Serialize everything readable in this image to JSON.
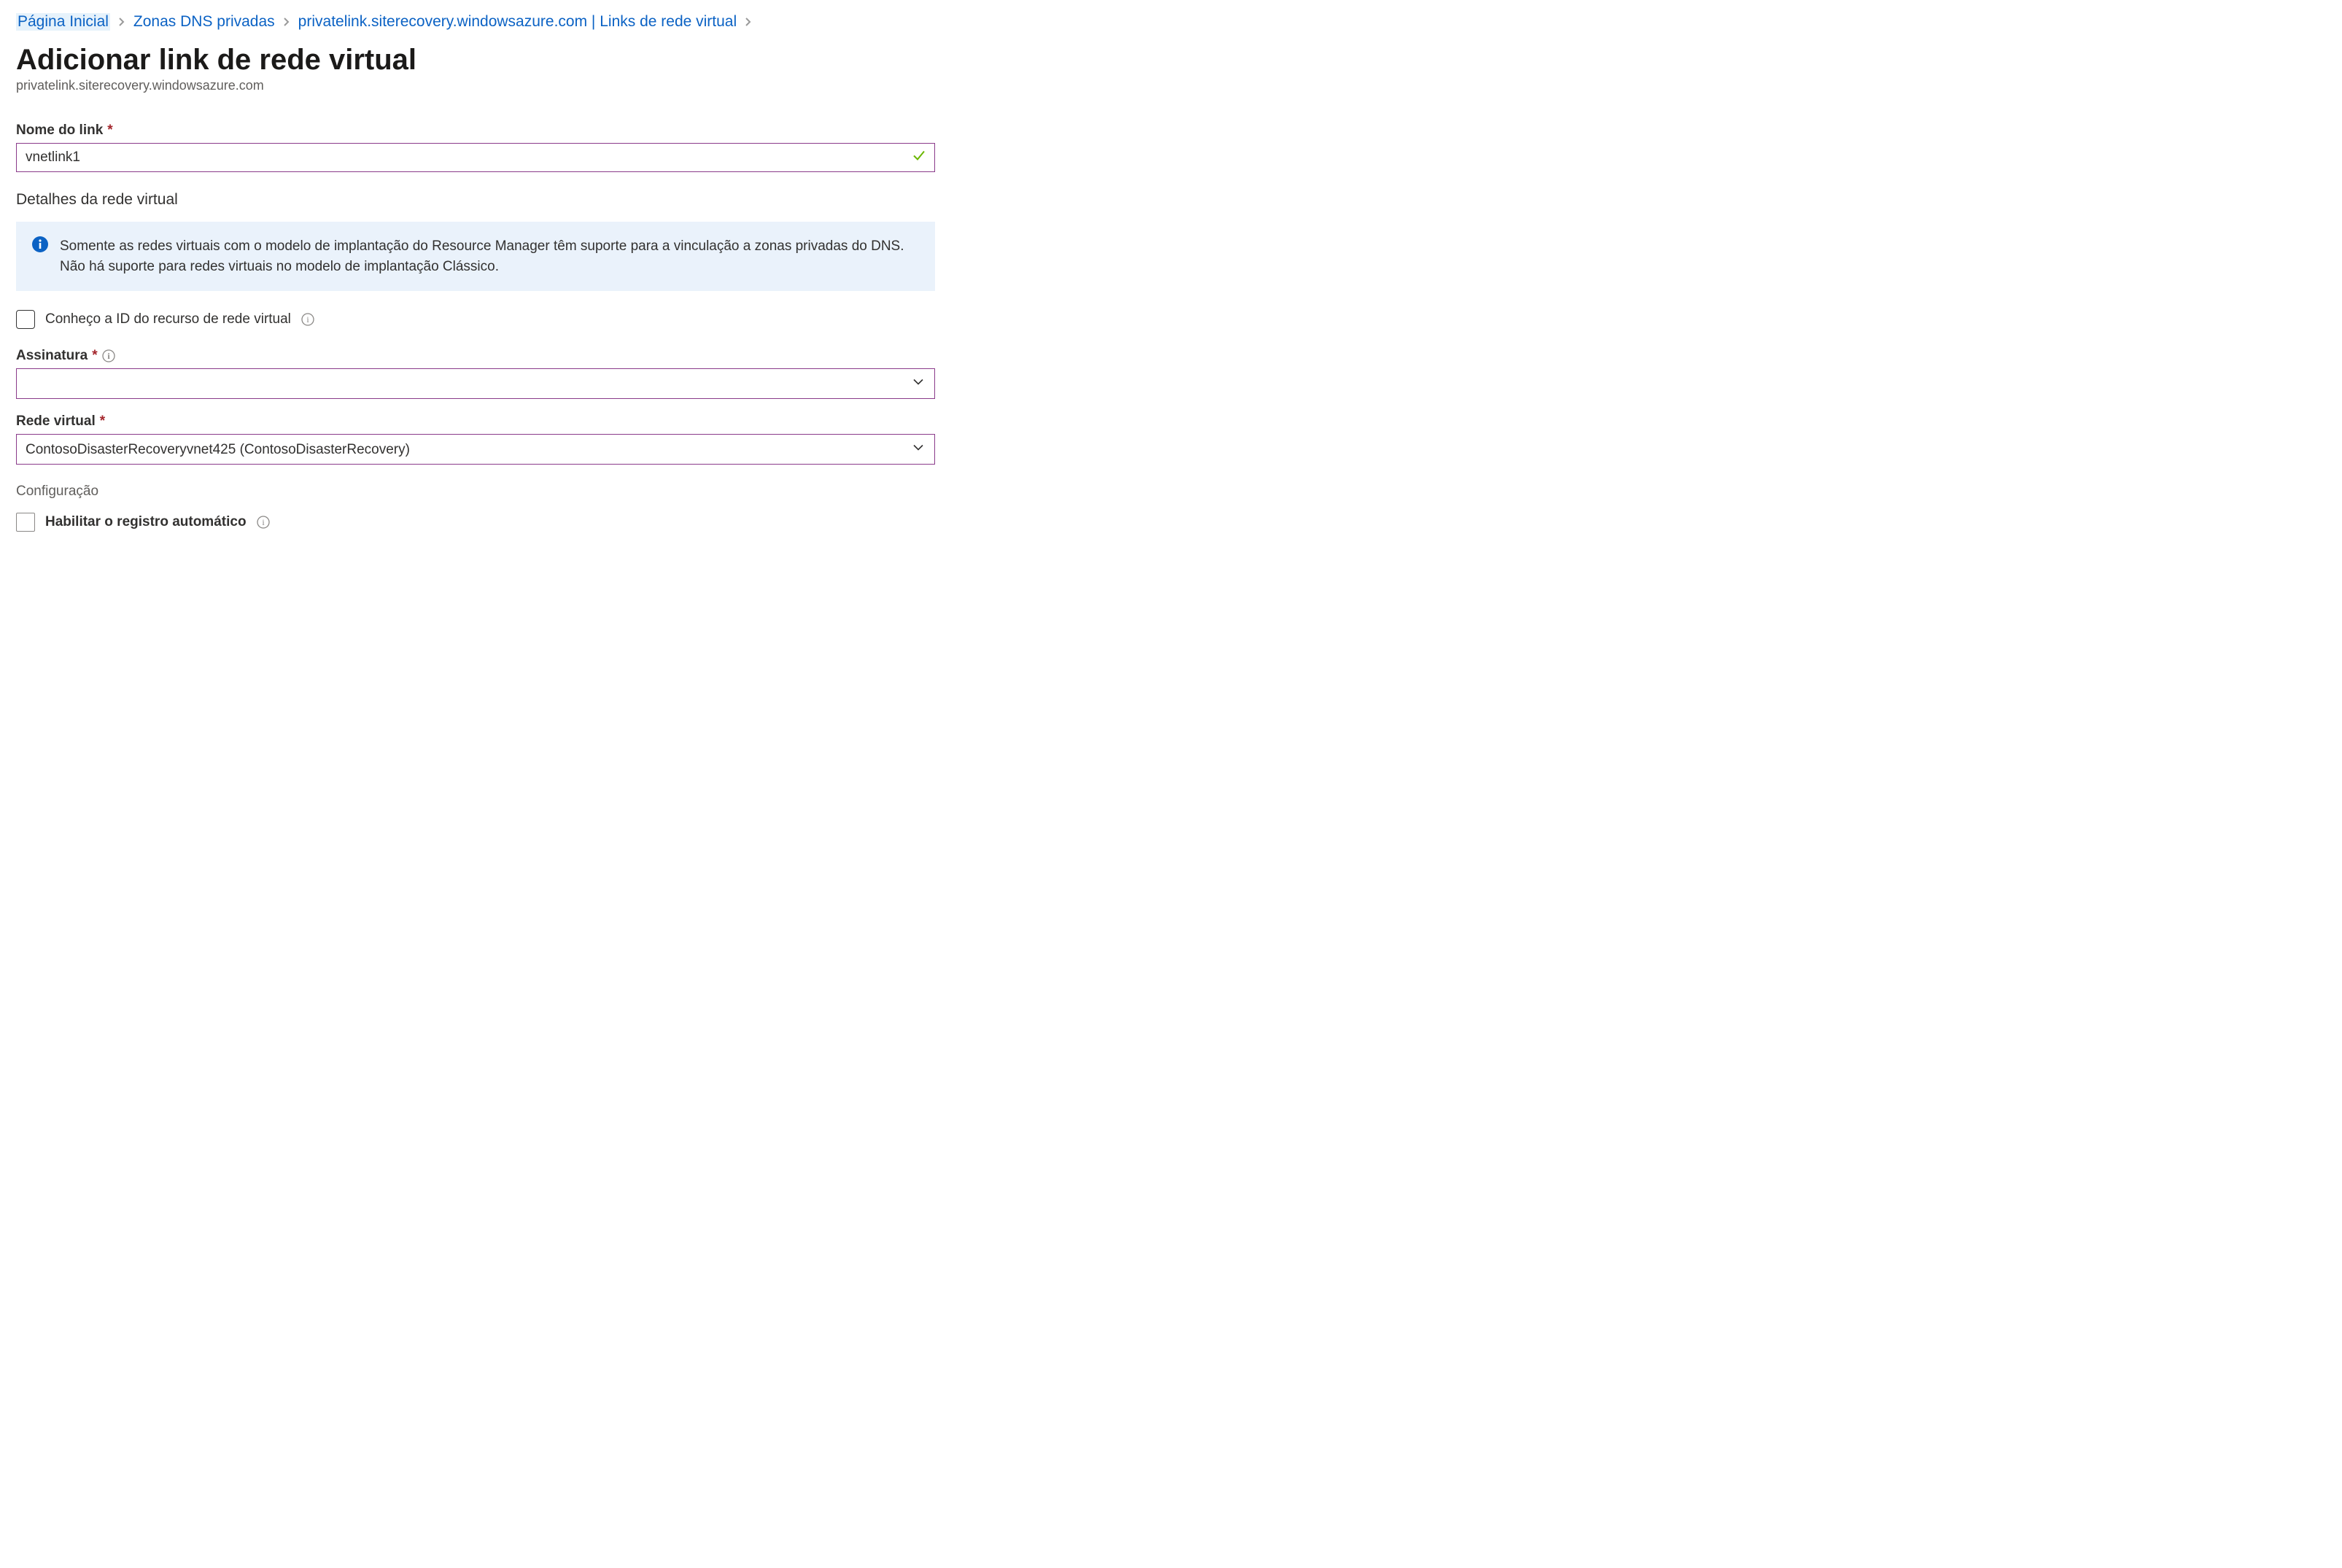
{
  "breadcrumb": {
    "home": "Página Inicial",
    "zones": "Zonas DNS privadas",
    "resource": "privatelink.siterecovery.windowsazure.com | Links de rede virtual"
  },
  "header": {
    "title": "Adicionar link de rede virtual",
    "subtitle": "privatelink.siterecovery.windowsazure.com"
  },
  "labels": {
    "linkName": "Nome do link",
    "vnetDetails": "Detalhes da rede virtual",
    "knowResourceId": "Conheço a ID do recurso de rede virtual",
    "subscription": "Assinatura",
    "virtualNetwork": "Rede virtual",
    "configuration": "Configuração",
    "enableAutoReg": "Habilitar o registro automático"
  },
  "values": {
    "linkName": "vnetlink1",
    "subscription": "",
    "virtualNetwork": "ContosoDisasterRecoveryvnet425 (ContosoDisasterRecovery)"
  },
  "info": {
    "message": "Somente as redes virtuais com o modelo de implantação do Resource Manager têm suporte para a vinculação a zonas privadas do DNS. Não há suporte para redes virtuais no modelo de implantação Clássico."
  }
}
